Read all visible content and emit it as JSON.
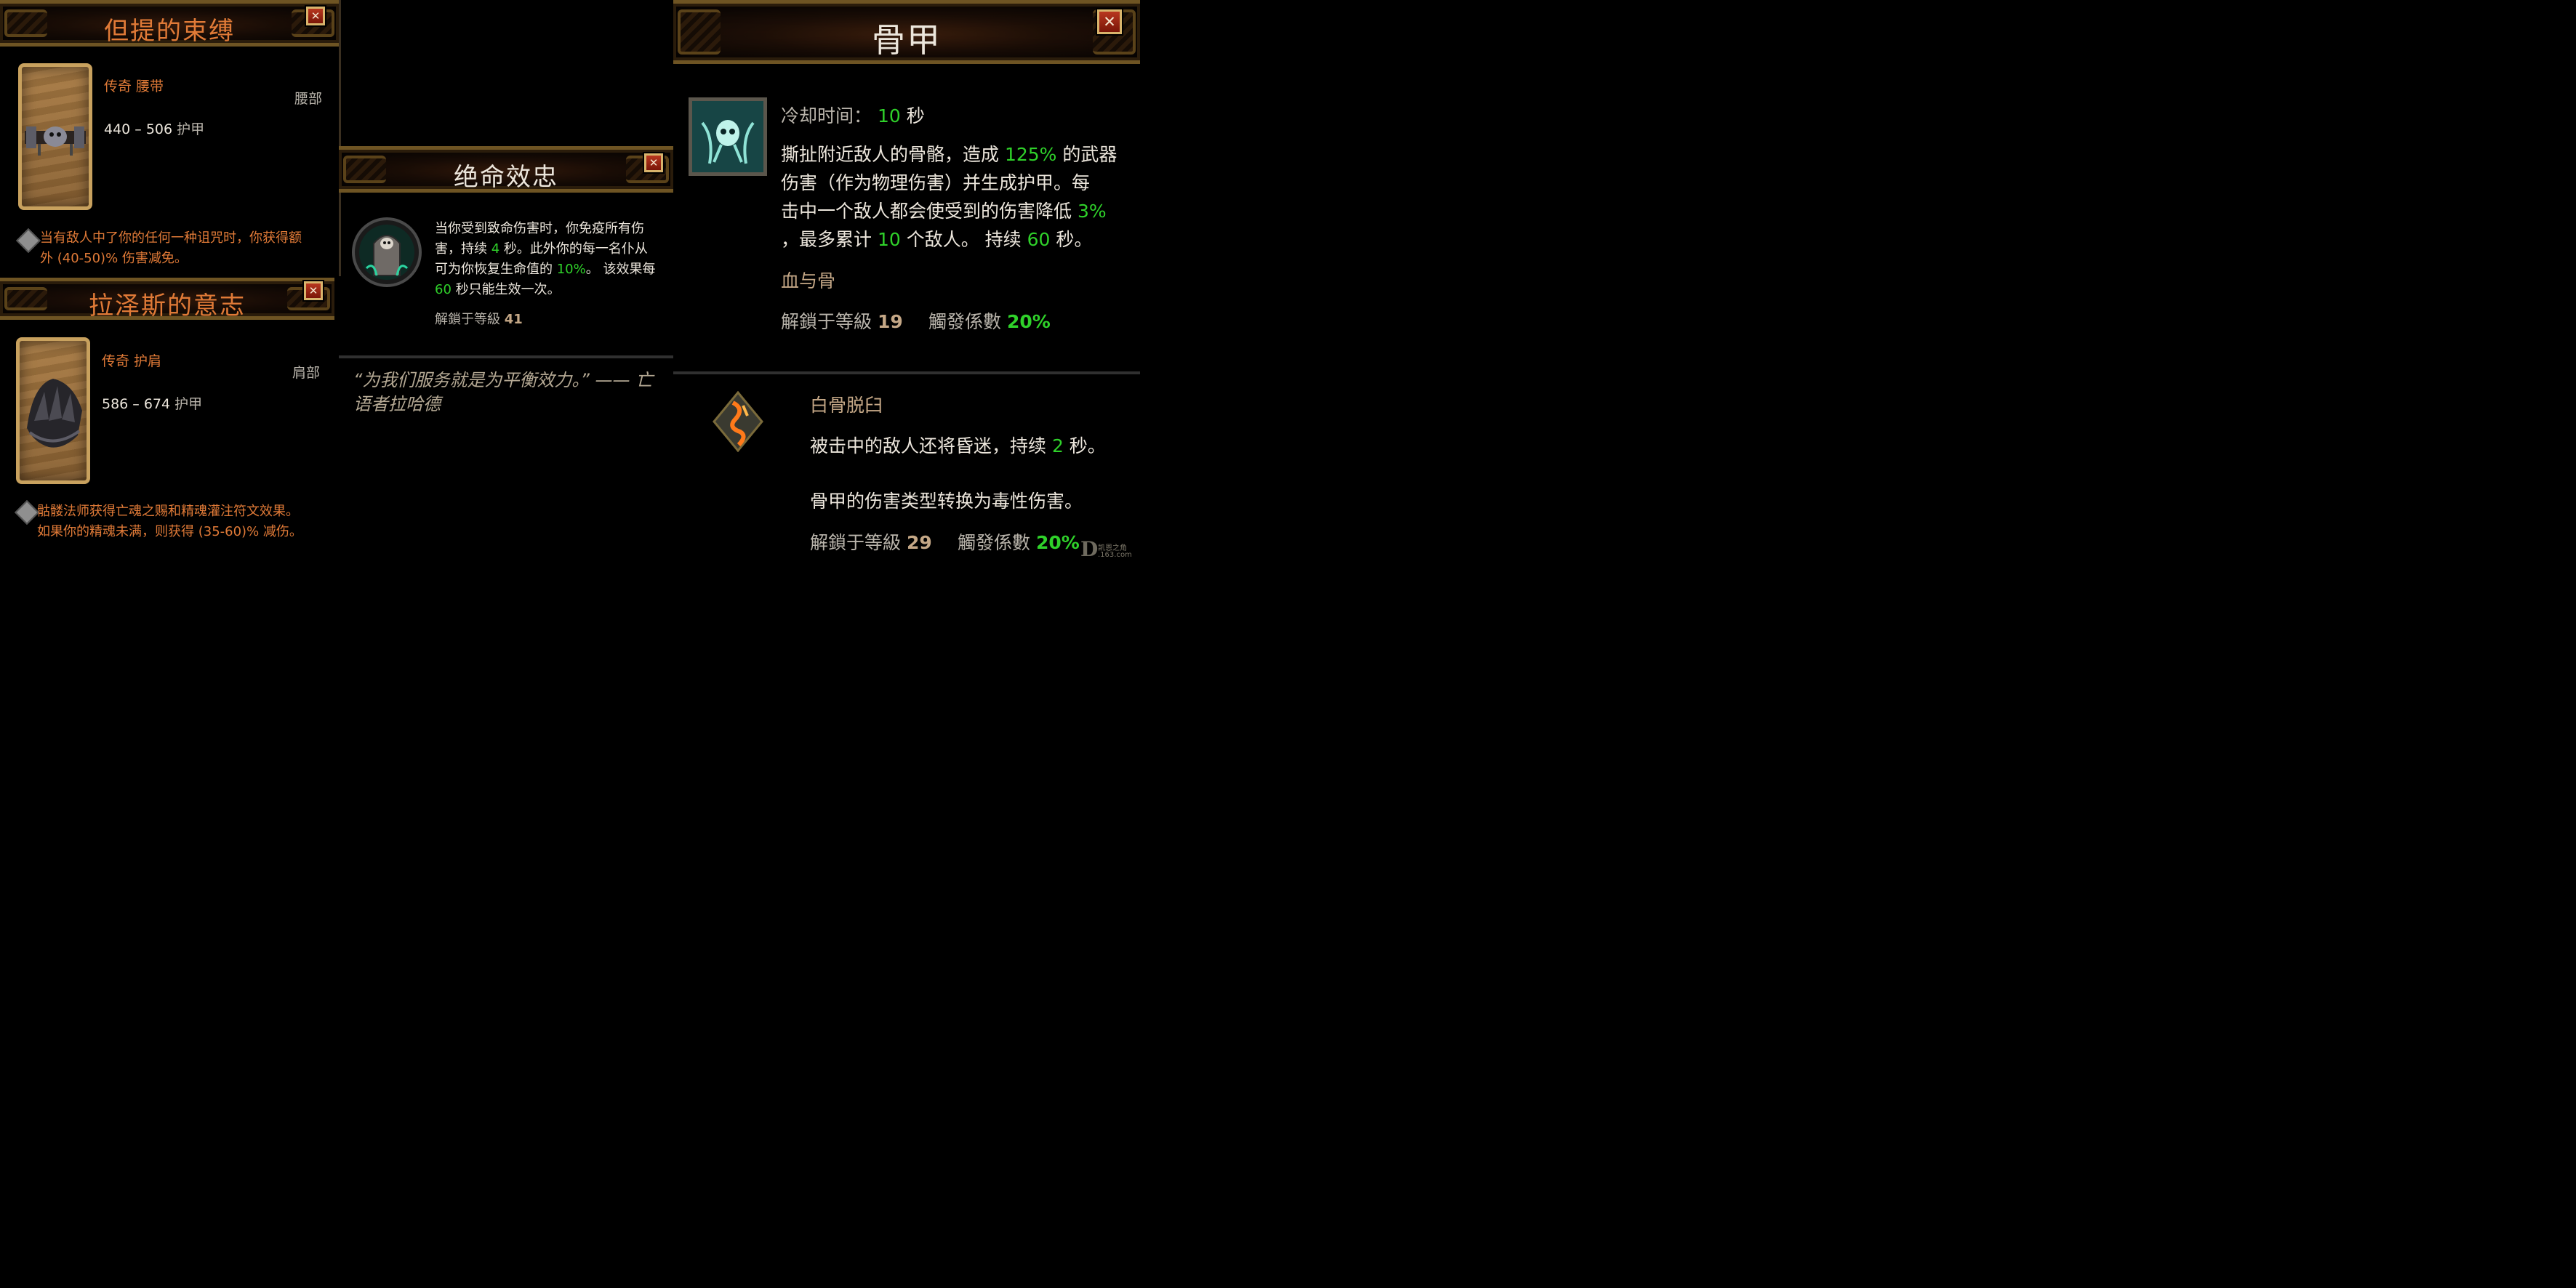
{
  "panel1": {
    "title": "但提的束缚",
    "close": "✕",
    "rarity_type": "传奇 腰带",
    "slot": "腰部",
    "armor_range": "440 – 506",
    "armor_unit": "护甲",
    "desc_line1": "当有敌人中了你的任何一种诅咒时，你获得额",
    "desc_line2": "外 (40-50)% 伤害减免。"
  },
  "panel2": {
    "title": "拉泽斯的意志",
    "close": "✕",
    "rarity_type": "传奇 护肩",
    "slot": "肩部",
    "armor_range": "586 – 674",
    "armor_unit": "护甲",
    "desc_line1": "骷髅法师获得亡魂之赐和精魂灌注符文效果。",
    "desc_line2": "如果你的精魂未满，则获得 (35-60)% 减伤。"
  },
  "panel3": {
    "title": "绝命效忠",
    "close": "✕",
    "l1": "当你受到致命伤害时，你免疫所有伤",
    "l2a": "害，持续 ",
    "l2num": "4",
    "l2b": " 秒。此外你的每一名仆从",
    "l3": "可为你恢复生命值的 ",
    "l3pct": "10%",
    "l3b": "。 该效果每",
    "l4num": "60",
    "l4b": " 秒只能生效一次。",
    "unlock_label": "解鎖于等級 ",
    "unlock_level": "41",
    "quote_line1": "“为我们服务就是为平衡效力。” —— 亡",
    "quote_line2": "语者拉哈德"
  },
  "panel4": {
    "title": "骨甲",
    "close": "✕",
    "cooldown_label": "冷却时间：",
    "cooldown_value": "10",
    "cooldown_unit": "秒",
    "d1a": "撕扯附近敌人的骨骼，造成 ",
    "d1pct": "125%",
    "d1b": " 的武器",
    "d2": "伤害（作为物理伤害）并生成护甲。每",
    "d3a": "击中一个敌人都会使受到的伤害降低 ",
    "d3pct": "3%",
    "d4a": "，最多累计 ",
    "d4num": "10",
    "d4b": " 个敌人。 持续 ",
    "d4num2": "60",
    "d4c": " 秒。",
    "rune_group": "血与骨",
    "unlock_label": "解鎖于等級 ",
    "unlock_level": "19",
    "proc_label": "觸發係數 ",
    "proc_value": "20%",
    "rune_name": "白骨脱臼",
    "r1a": "被击中的敌人还将昏迷，持续 ",
    "r1num": "2",
    "r1b": " 秒。",
    "r2": "骨甲的伤害类型转换为毒性伤害。",
    "rune_unlock_label": "解鎖于等級 ",
    "rune_unlock_level": "29",
    "rune_proc_label": "觸發係數 ",
    "rune_proc_value": "20%"
  },
  "watermark": {
    "line1": "凯恩之角",
    "line2": ".163.com",
    "mark": "D"
  },
  "colors": {
    "orange": "#e07a37",
    "green": "#2fd12a",
    "gold_frame": "#c8a15e",
    "close_red": "#9d2610"
  }
}
